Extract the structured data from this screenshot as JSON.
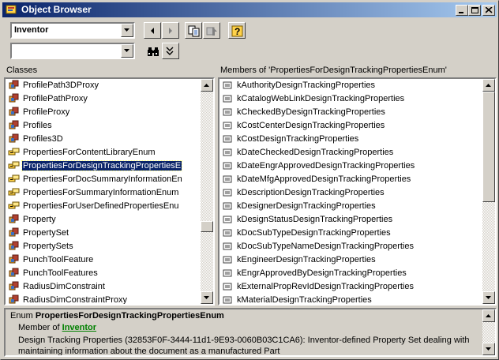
{
  "window": {
    "title": "Object Browser"
  },
  "toolbar": {
    "library_value": "Inventor",
    "search_value": ""
  },
  "classes": {
    "header": "Classes",
    "items": [
      {
        "label": "ProfilePath3DProxy",
        "icon": "class-icon"
      },
      {
        "label": "ProfilePathProxy",
        "icon": "class-icon"
      },
      {
        "label": "ProfileProxy",
        "icon": "class-icon"
      },
      {
        "label": "Profiles",
        "icon": "class-icon"
      },
      {
        "label": "Profiles3D",
        "icon": "class-icon"
      },
      {
        "label": "PropertiesForContentLibraryEnum",
        "icon": "enum-icon"
      },
      {
        "label": "PropertiesForDesignTrackingPropertiesE",
        "icon": "enum-icon",
        "selected": true
      },
      {
        "label": "PropertiesForDocSummaryInformationEn",
        "icon": "enum-icon"
      },
      {
        "label": "PropertiesForSummaryInformationEnum",
        "icon": "enum-icon"
      },
      {
        "label": "PropertiesForUserDefinedPropertiesEnu",
        "icon": "enum-icon"
      },
      {
        "label": "Property",
        "icon": "class-icon"
      },
      {
        "label": "PropertySet",
        "icon": "class-icon"
      },
      {
        "label": "PropertySets",
        "icon": "class-icon"
      },
      {
        "label": "PunchToolFeature",
        "icon": "class-icon"
      },
      {
        "label": "PunchToolFeatures",
        "icon": "class-icon"
      },
      {
        "label": "RadiusDimConstraint",
        "icon": "class-icon"
      },
      {
        "label": "RadiusDimConstraintProxy",
        "icon": "class-icon"
      }
    ]
  },
  "members": {
    "header": "Members of 'PropertiesForDesignTrackingPropertiesEnum'",
    "items": [
      "kAuthorityDesignTrackingProperties",
      "kCatalogWebLinkDesignTrackingProperties",
      "kCheckedByDesignTrackingProperties",
      "kCostCenterDesignTrackingProperties",
      "kCostDesignTrackingProperties",
      "kDateCheckedDesignTrackingProperties",
      "kDateEngrApprovedDesignTrackingProperties",
      "kDateMfgApprovedDesignTrackingProperties",
      "kDescriptionDesignTrackingProperties",
      "kDesignerDesignTrackingProperties",
      "kDesignStatusDesignTrackingProperties",
      "kDocSubTypeDesignTrackingProperties",
      "kDocSubTypeNameDesignTrackingProperties",
      "kEngineerDesignTrackingProperties",
      "kEngrApprovedByDesignTrackingProperties",
      "kExternalPropRevIdDesignTrackingProperties",
      "kMaterialDesignTrackingProperties"
    ]
  },
  "details": {
    "kind": "Enum",
    "name": "PropertiesForDesignTrackingPropertiesEnum",
    "member_of_prefix": "Member of",
    "member_of_link": "Inventor",
    "description": "Design Tracking Properties (32853F0F-3444-11d1-9E93-0060B03C1CA6): Inventor-defined Property Set dealing with maintaining information about the document as a manufactured Part"
  },
  "colors": {
    "title_bar": "#0a246a",
    "selection": "#0a246a",
    "link": "#008000"
  }
}
